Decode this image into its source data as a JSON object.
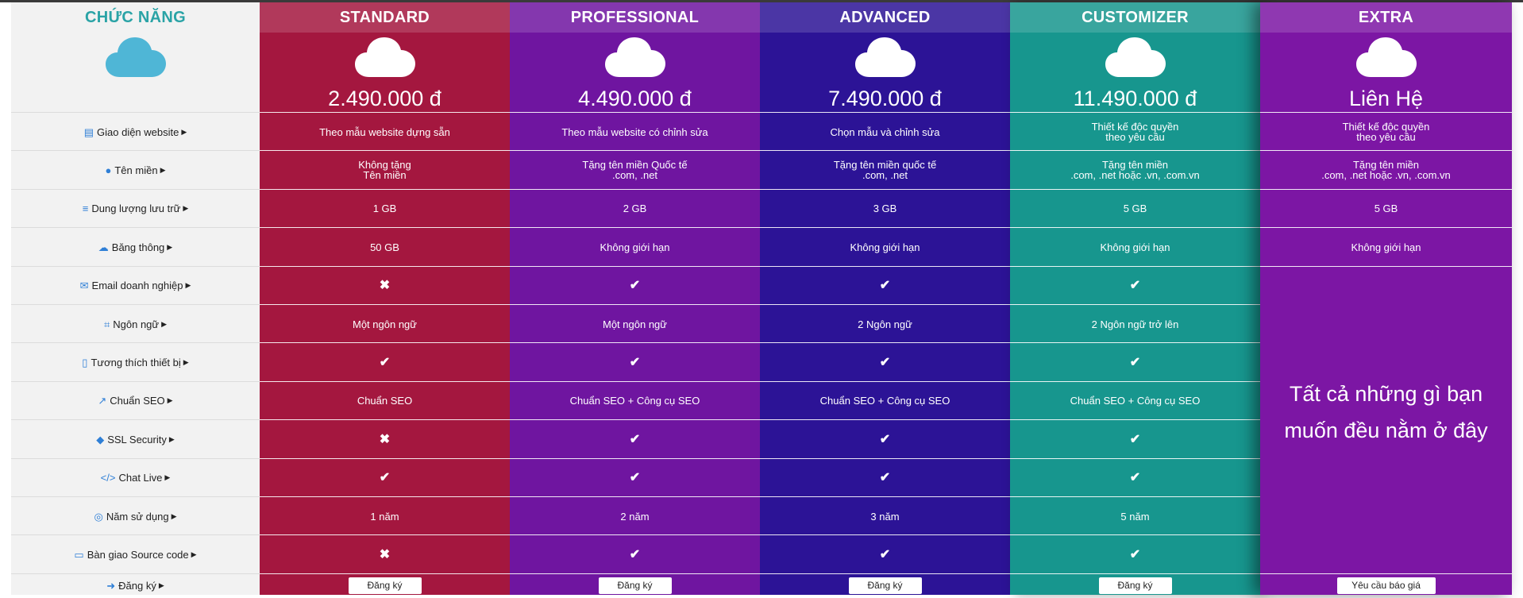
{
  "features": {
    "title": "CHỨC NĂNG",
    "items": [
      {
        "label": "Giao diện website",
        "icon": "layout-icon"
      },
      {
        "label": "Tên miền",
        "icon": "globe-icon"
      },
      {
        "label": "Dung lượng lưu trữ",
        "icon": "database-icon"
      },
      {
        "label": "Băng thông",
        "icon": "cloud-icon"
      },
      {
        "label": "Email doanh nghiệp",
        "icon": "envelope-icon"
      },
      {
        "label": "Ngôn ngữ",
        "icon": "language-icon"
      },
      {
        "label": "Tương thích thiết bị",
        "icon": "mobile-icon"
      },
      {
        "label": "Chuẩn SEO",
        "icon": "chart-line-icon"
      },
      {
        "label": "SSL Security",
        "icon": "shield-icon"
      },
      {
        "label": "Chat Live",
        "icon": "code-icon"
      },
      {
        "label": "Năm sử dụng",
        "icon": "lifebuoy-icon"
      },
      {
        "label": "Bàn giao Source code",
        "icon": "file-code-icon"
      },
      {
        "label": "Đăng ký",
        "icon": "sign-in-icon"
      }
    ]
  },
  "plans": [
    {
      "name": "STANDARD",
      "price": "2.490.000 đ",
      "color": "#a4173f",
      "values": [
        [
          "Theo mẫu website dựng sẵn"
        ],
        [
          "Không tặng",
          "Tên miền"
        ],
        [
          "1 GB"
        ],
        [
          "50 GB"
        ],
        [
          "✖"
        ],
        [
          "Một ngôn ngữ"
        ],
        [
          "✔"
        ],
        [
          "Chuẩn SEO"
        ],
        [
          "✖"
        ],
        [
          "✔"
        ],
        [
          "1 năm"
        ],
        [
          "✖"
        ]
      ],
      "button": "Đăng ký"
    },
    {
      "name": "PROFESSIONAL",
      "price": "4.490.000 đ",
      "color": "#6f15a0",
      "values": [
        [
          "Theo mẫu website có chỉnh sửa"
        ],
        [
          "Tặng tên miền Quốc tế",
          ".com, .net"
        ],
        [
          "2 GB"
        ],
        [
          "Không giới hạn"
        ],
        [
          "✔"
        ],
        [
          "Một ngôn ngữ"
        ],
        [
          "✔"
        ],
        [
          "Chuẩn SEO + Công cụ SEO"
        ],
        [
          "✔"
        ],
        [
          "✔"
        ],
        [
          "2 năm"
        ],
        [
          "✔"
        ]
      ],
      "button": "Đăng ký"
    },
    {
      "name": "ADVANCED",
      "price": "7.490.000 đ",
      "color": "#2c1396",
      "values": [
        [
          "Chọn mẫu và chỉnh sửa"
        ],
        [
          "Tặng tên miền quốc tế",
          ".com, .net"
        ],
        [
          "3 GB"
        ],
        [
          "Không giới hạn"
        ],
        [
          "✔"
        ],
        [
          "2 Ngôn ngữ"
        ],
        [
          "✔"
        ],
        [
          "Chuẩn SEO + Công cụ SEO"
        ],
        [
          "✔"
        ],
        [
          "✔"
        ],
        [
          "3 năm"
        ],
        [
          "✔"
        ]
      ],
      "button": "Đăng ký"
    },
    {
      "name": "CUSTOMIZER",
      "price": "11.490.000 đ",
      "color": "#17968e",
      "values": [
        [
          "Thiết kế độc quyền",
          "theo yêu cầu"
        ],
        [
          "Tặng tên miền",
          ".com, .net hoặc .vn, .com.vn"
        ],
        [
          "5 GB"
        ],
        [
          "Không giới hạn"
        ],
        [
          "✔"
        ],
        [
          "2 Ngôn ngữ trở lên"
        ],
        [
          "✔"
        ],
        [
          "Chuẩn SEO + Công cụ SEO"
        ],
        [
          "✔"
        ],
        [
          "✔"
        ],
        [
          "5 năm"
        ],
        [
          "✔"
        ]
      ],
      "button": "Đăng ký"
    }
  ],
  "extra": {
    "name": "EXTRA",
    "price": "Liên Hệ",
    "color": "#7c16a4",
    "values": [
      [
        "Thiết kế độc quyền",
        "theo yêu cầu"
      ],
      [
        "Tặng tên miền",
        ".com, .net hoặc .vn, .com.vn"
      ],
      [
        "5 GB"
      ],
      [
        "Không giới hạn"
      ]
    ],
    "message": "Tất cả những gì bạn muốn đều nằm ở đây",
    "button": "Yêu cầu báo giá"
  }
}
